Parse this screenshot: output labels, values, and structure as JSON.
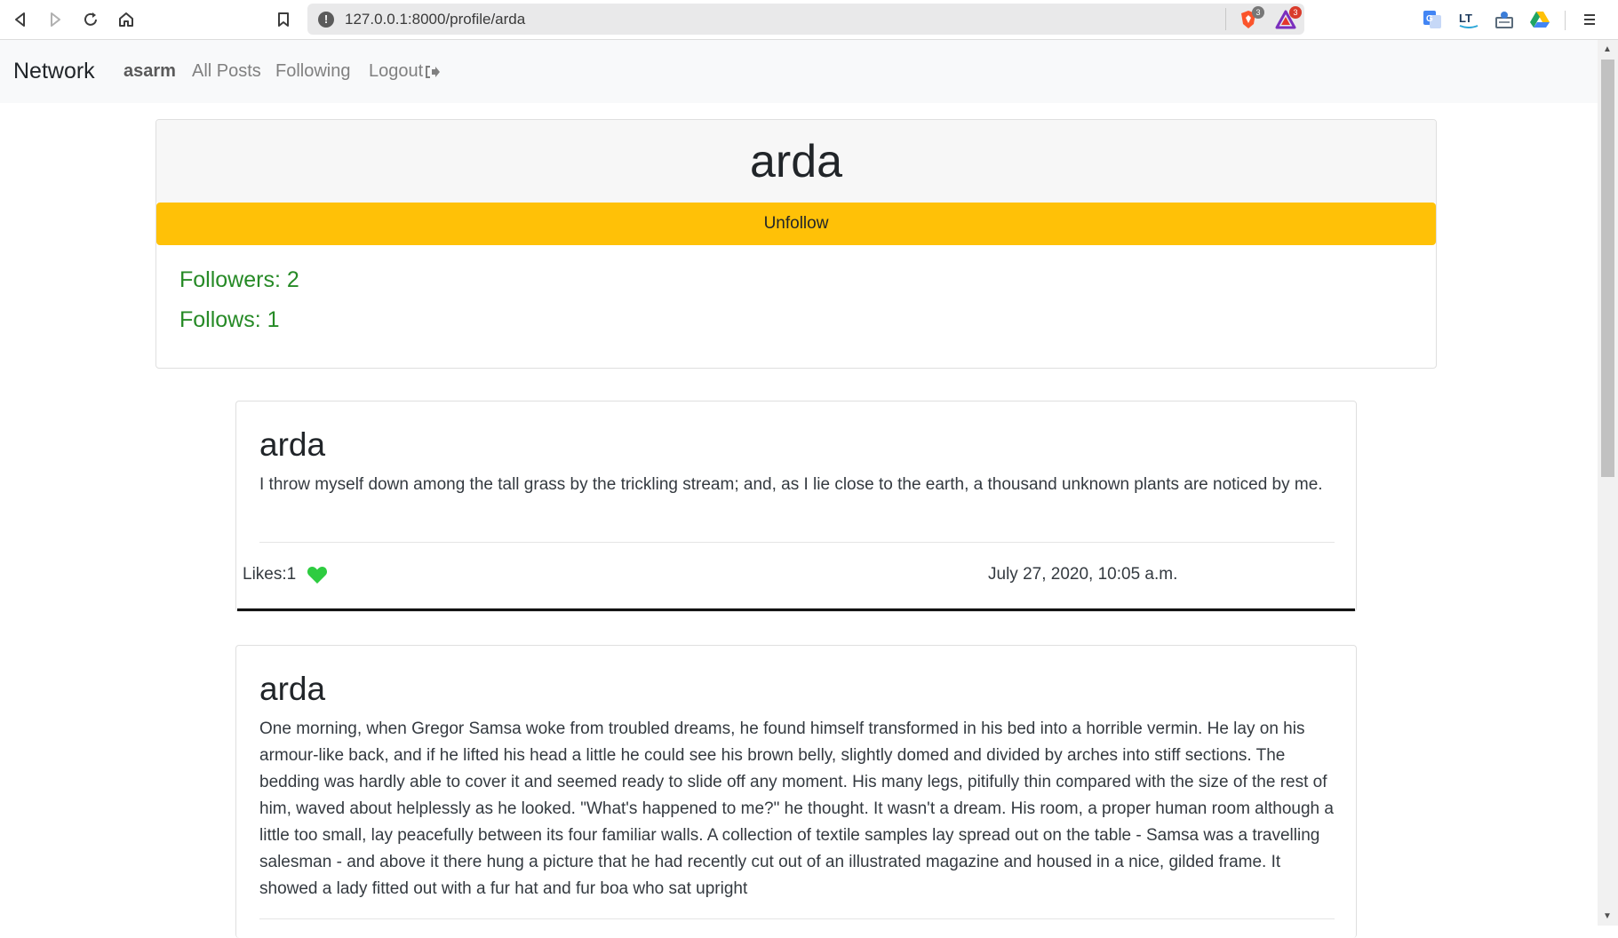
{
  "browser": {
    "url": "127.0.0.1:8000/profile/arda",
    "brave_badge": "3",
    "rewards_badge": "3"
  },
  "nav": {
    "brand": "Network",
    "user": "asarm",
    "all_posts": "All Posts",
    "following": "Following",
    "logout": "Logout"
  },
  "profile": {
    "name": "arda",
    "action_label": "Unfollow",
    "followers": "Followers: 2",
    "follows": "Follows: 1"
  },
  "posts": [
    {
      "author": "arda",
      "body": "I throw myself down among the tall grass by the trickling stream; and, as I lie close to the earth, a thousand unknown plants are noticed by me.",
      "likes": "Likes:1",
      "date": "July 27, 2020, 10:05 a.m."
    },
    {
      "author": "arda",
      "body": "One morning, when Gregor Samsa woke from troubled dreams, he found himself transformed in his bed into a horrible vermin. He lay on his armour-like back, and if he lifted his head a little he could see his brown belly, slightly domed and divided by arches into stiff sections. The bedding was hardly able to cover it and seemed ready to slide off any moment. His many legs, pitifully thin compared with the size of the rest of him, waved about helplessly as he looked. \"What's happened to me?\" he thought. It wasn't a dream. His room, a proper human room although a little too small, lay peacefully between its four familiar walls. A collection of textile samples lay spread out on the table - Samsa was a travelling salesman - and above it there hung a picture that he had recently cut out of an illustrated magazine and housed in a nice, gilded frame. It showed a lady fitted out with a fur hat and fur boa who sat upright"
    }
  ],
  "colors": {
    "accent_button": "#ffc107",
    "stat_text": "#268a26",
    "heart": "#2ecc40"
  }
}
